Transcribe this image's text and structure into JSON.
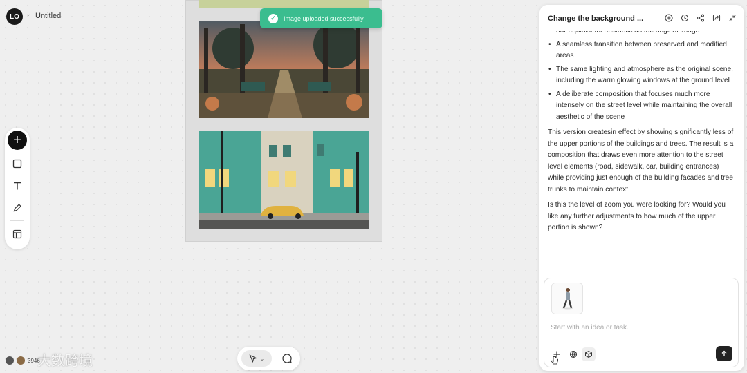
{
  "app": {
    "logo_text": "LO",
    "document_title": "Untitled"
  },
  "toast": {
    "message": "Image uploaded successfully"
  },
  "toolbar": {
    "tools": [
      "add-icon",
      "rectangle-icon",
      "text-icon",
      "pen-icon",
      "layout-icon"
    ]
  },
  "bottom_left": {
    "count": "3946",
    "watermark": "大数跨境"
  },
  "panel": {
    "title": "Change the background ...",
    "partial_line": "our equidistant aesthetic as the original image",
    "bullets": [
      "A seamless transition between preserved and modified areas",
      "The same lighting and atmosphere as the original scene, including the warm glowing windows at the ground level",
      "A deliberate composition that focuses much more intensely on the street level while maintaining the overall aesthetic of the scene"
    ],
    "paragraph1": "This version createsin effect by showing significantly less of the upper portions of the buildings and trees. The result is a composition that draws even more attention to the street level elements (road, sidewalk, car, building entrances) while providing just enough of the building facades and tree trunks to maintain context.",
    "paragraph2": "Is this the level of zoom you were looking for? Would you like any further adjustments to how much of the upper portion is shown?"
  },
  "composer": {
    "placeholder": "Start with an idea or task."
  },
  "colors": {
    "toast_green": "#3bbd8f",
    "canvas_bg": "#efefef",
    "building_teal": "#4aa595",
    "car_yellow": "#e0b23f"
  }
}
